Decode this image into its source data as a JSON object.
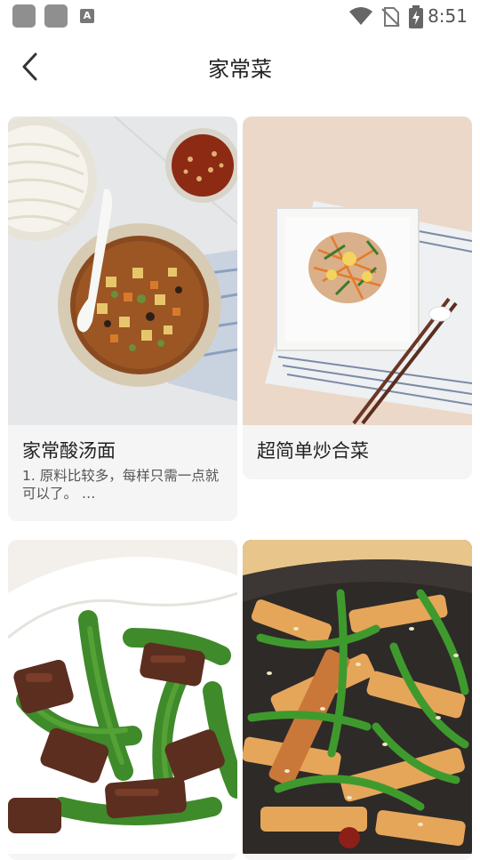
{
  "status_bar": {
    "time": "8:51",
    "indicator_letter": "A"
  },
  "header": {
    "title": "家常菜"
  },
  "recipes": [
    {
      "title": "家常酸汤面",
      "desc": "1. 原料比较多，每样只需一点就可以了。 …"
    },
    {
      "title": "超简单炒合菜",
      "desc": ""
    },
    {
      "title": "",
      "desc": ""
    },
    {
      "title": "",
      "desc": ""
    }
  ]
}
